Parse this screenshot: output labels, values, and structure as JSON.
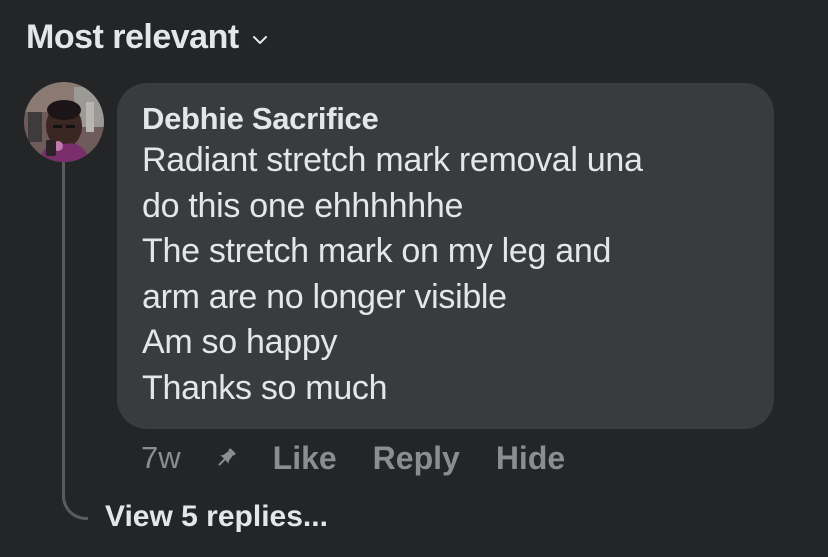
{
  "sort": {
    "label": "Most relevant",
    "icon": "chevron-down-icon"
  },
  "comment": {
    "author": "Debhie Sacrifice",
    "lines": [
      "Radiant stretch mark removal una",
      "do this one ehhhhhhe",
      "The stretch mark on my leg and",
      "arm are no longer visible",
      "Am so happy",
      "Thanks so much"
    ],
    "time": "7w",
    "pin_icon": "pin-icon",
    "actions": {
      "like": "Like",
      "reply": "Reply",
      "hide": "Hide"
    }
  },
  "replies": {
    "label": "View 5 replies..."
  },
  "colors": {
    "background": "#242526",
    "bubble": "#3a3b3c",
    "primary_text": "#e4e6eb",
    "secondary_text": "#8a8d91"
  }
}
